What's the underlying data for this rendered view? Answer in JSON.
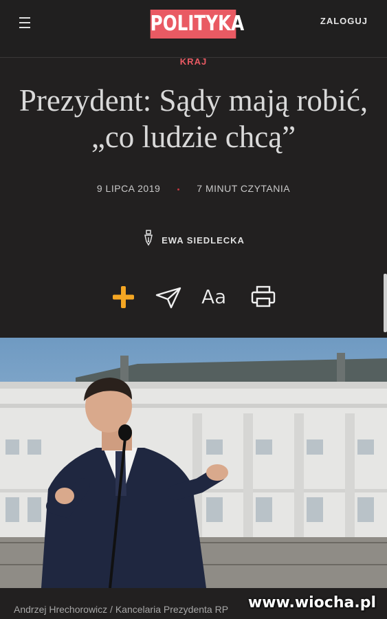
{
  "header": {
    "logo_text": "POLITYKA",
    "login_label": "ZALOGUJ",
    "brand_color": "#e95a63"
  },
  "article": {
    "section": "KRAJ",
    "title": "Prezydent: Sądy mają robić, „co ludzie chcą”",
    "date": "9 LIPCA 2019",
    "reading_time": "7 MINUT CZYTANIA",
    "author": "EWA SIEDLECKA",
    "photo_caption": "Andrzej Hrechorowicz / Kancelaria Prezydenta RP"
  },
  "toolbar": {
    "add_icon": "plus-icon",
    "share_icon": "send-icon",
    "font_size_label": "Aa",
    "print_icon": "printer-icon"
  },
  "watermark": "www.wiocha.pl"
}
